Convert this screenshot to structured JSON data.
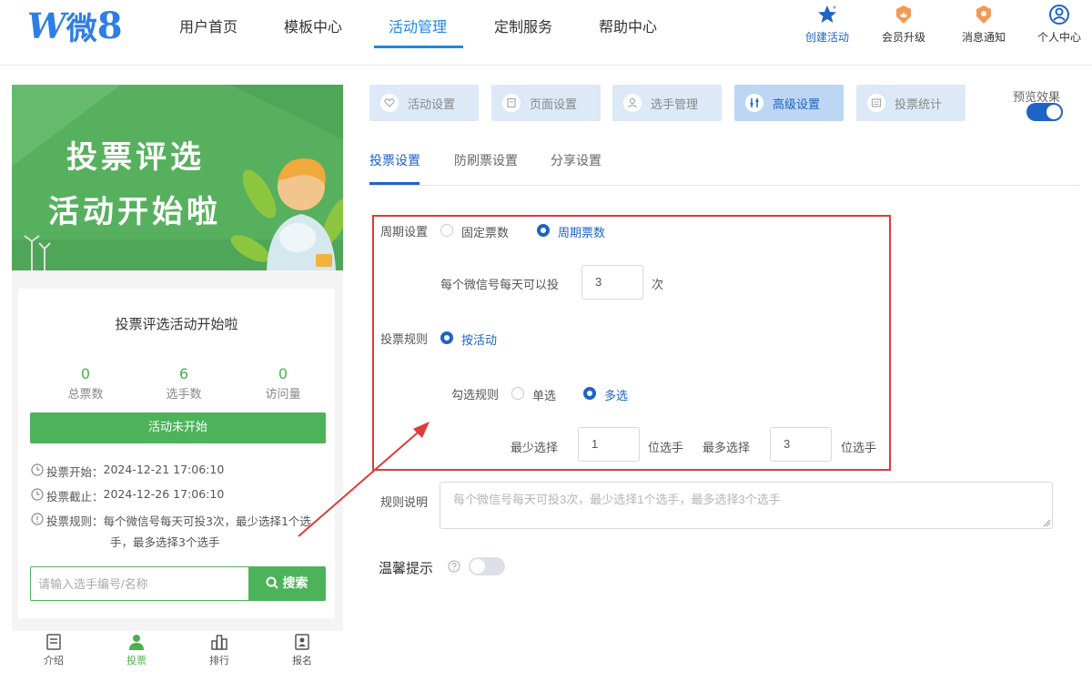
{
  "header": {
    "logo": {
      "w": "W",
      "wei": "微",
      "eight": "8"
    },
    "nav": [
      "用户首页",
      "模板中心",
      "活动管理",
      "定制服务",
      "帮助中心"
    ],
    "tools": [
      "创建活动",
      "会员升级",
      "消息通知",
      "个人中心"
    ]
  },
  "preview": {
    "banner": {
      "line1": "投票评选",
      "line2": "活动开始啦"
    },
    "title": "投票评选活动开始啦",
    "stats": [
      {
        "value": "0",
        "label": "总票数"
      },
      {
        "value": "6",
        "label": "选手数"
      },
      {
        "value": "0",
        "label": "访问量"
      }
    ],
    "status_button": "活动未开始",
    "start_label": "投票开始：",
    "start_time": "2024-12-21 17:06:10",
    "end_label": "投票截止：",
    "end_time": "2024-12-26 17:06:10",
    "rule_label": "投票规则：",
    "rule_line1": "每个微信号每天可投3次，最少选择1个选",
    "rule_line2": "手，最多选择3个选手",
    "search_placeholder": "请输入选手编号/名称",
    "search_button": "搜索",
    "tabs": [
      "介绍",
      "投票",
      "排行",
      "报名"
    ]
  },
  "steps": [
    "活动设置",
    "页面设置",
    "选手管理",
    "高级设置",
    "投票统计"
  ],
  "preview_toggle": {
    "label": "预览效果",
    "on": true
  },
  "subtabs": [
    "投票设置",
    "防刷票设置",
    "分享设置"
  ],
  "form": {
    "cycle_label": "周期设置",
    "cycle_options": [
      "固定票数",
      "周期票数"
    ],
    "cycle_selected": 1,
    "daily_label": "每个微信号每天可以投",
    "daily_value": "3",
    "daily_unit": "次",
    "rule_label": "投票规则",
    "rule_option": "按活动",
    "check_label": "勾选规则",
    "check_options": [
      "单选",
      "多选"
    ],
    "check_selected": 1,
    "min_label": "最少选择",
    "min_value": "1",
    "min_unit": "位选手",
    "max_label": "最多选择",
    "max_value": "3",
    "max_unit": "位选手",
    "desc_label": "规则说明",
    "desc_placeholder": "每个微信号每天可投3次，最少选择1个选手，最多选择3个选手",
    "tips_label": "温馨提示",
    "tips_on": false
  },
  "colors": {
    "accent": "#1e63c6",
    "green": "#4cb35a",
    "annotation": "#e03a3a"
  }
}
